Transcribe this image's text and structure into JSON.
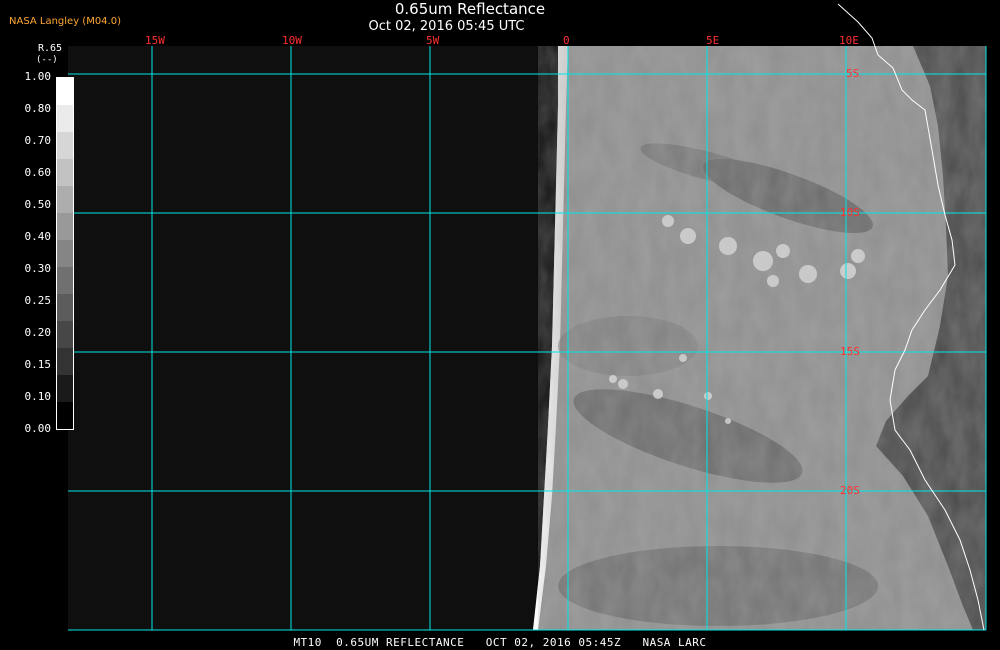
{
  "title": "0.65um Reflectance",
  "subtitle": "Oct 02, 2016 05:45 UTC",
  "source_label": "NASA Langley (M04.0)",
  "footer": "MT10  0.65UM REFLECTANCE   OCT 02, 2016 05:45Z   NASA LARC",
  "colorbar": {
    "title": "R.65",
    "unit": "(--)",
    "ticks": [
      "1.00",
      "0.80",
      "0.70",
      "0.60",
      "0.50",
      "0.40",
      "0.30",
      "0.25",
      "0.20",
      "0.15",
      "0.10",
      "0.00"
    ],
    "shades": [
      "#ffffff",
      "#ebebeb",
      "#d6d6d6",
      "#c2c2c2",
      "#adadad",
      "#999999",
      "#858585",
      "#707070",
      "#5c5c5c",
      "#474747",
      "#333333",
      "#1a1a1a",
      "#000000"
    ]
  },
  "map": {
    "longitude_labels": [
      "15W",
      "10W",
      "5W",
      "0",
      "5E",
      "10E"
    ],
    "latitude_labels": [
      "5S",
      "10S",
      "15S",
      "20S"
    ],
    "grid_color": "#00e6e6",
    "label_color": "#ff3030",
    "coastline_color": "#ffffff",
    "no_data_color": "#0f0f0f"
  }
}
